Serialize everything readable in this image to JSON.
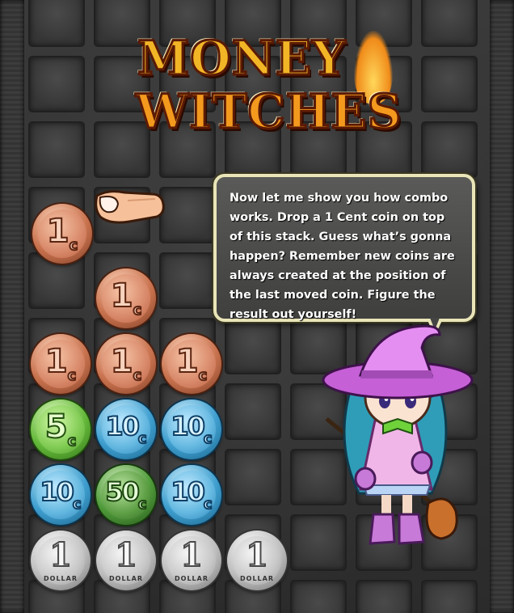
{
  "game": {
    "title_line1": "MONEY",
    "title_line2": "WITCHES"
  },
  "tutorial": {
    "message": "Now let me show you how combo works. Drop a 1 Cent coin on top of this stack. Guess what’s gonna happen? Remember new coins are always created at the position of the last moved coin. Figure the result out yourself!"
  },
  "board": {
    "held_coin": {
      "value": "1",
      "unit": "c",
      "type": "copper"
    },
    "rows": [
      [
        null,
        {
          "value": "1",
          "unit": "c",
          "type": "copper"
        },
        null,
        null
      ],
      [
        {
          "value": "1",
          "unit": "c",
          "type": "copper"
        },
        {
          "value": "1",
          "unit": "c",
          "type": "copper"
        },
        {
          "value": "1",
          "unit": "c",
          "type": "copper"
        },
        null
      ],
      [
        {
          "value": "5",
          "unit": "c",
          "type": "green"
        },
        {
          "value": "10",
          "unit": "c",
          "type": "blue"
        },
        {
          "value": "10",
          "unit": "c",
          "type": "blue"
        },
        null
      ],
      [
        {
          "value": "10",
          "unit": "c",
          "type": "blue"
        },
        {
          "value": "50",
          "unit": "c",
          "type": "darkgreen"
        },
        {
          "value": "10",
          "unit": "c",
          "type": "blue"
        },
        null
      ],
      [
        {
          "value": "1",
          "unit": "DOLLAR",
          "type": "silver"
        },
        {
          "value": "1",
          "unit": "DOLLAR",
          "type": "silver"
        },
        {
          "value": "1",
          "unit": "DOLLAR",
          "type": "silver"
        },
        {
          "value": "1",
          "unit": "DOLLAR",
          "type": "silver"
        }
      ]
    ]
  },
  "icons": {
    "pointer": "finger-pointer-icon",
    "character": "witch-character"
  },
  "colors": {
    "bubble_border": "#e9e5b8",
    "logo_gold": "#f2b526",
    "copper": "#d8896a",
    "blue": "#62b7e0",
    "green": "#7fcb52",
    "silver": "#c8c8c8"
  }
}
